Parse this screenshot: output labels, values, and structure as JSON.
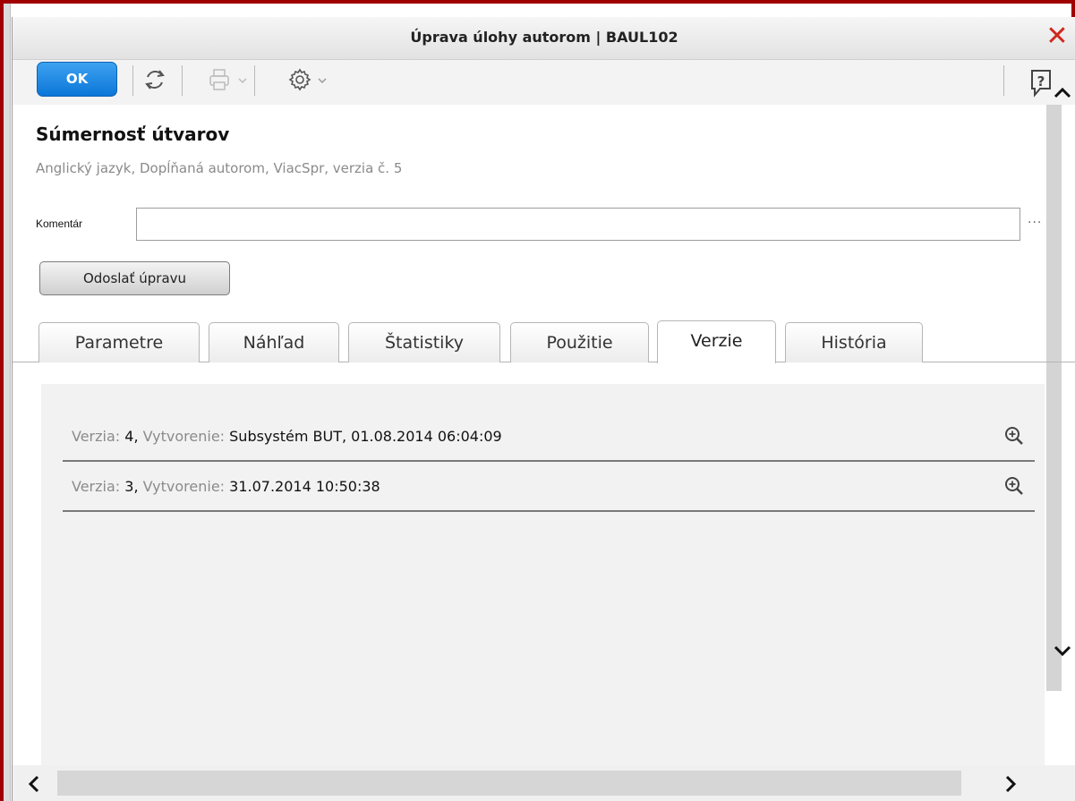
{
  "window": {
    "title": "Úprava úlohy autorom | BAUL102",
    "close_icon": "close-x-icon",
    "close_color": "#d0271d",
    "frame_color": "#a00000"
  },
  "toolbar": {
    "ok_label": "OK",
    "ok_color": "#1a85e2",
    "icons": [
      "refresh-icon",
      "print-icon",
      "settings-gear-icon",
      "help-icon"
    ]
  },
  "task": {
    "title": "Súmernosť útvarov",
    "subtitle": "Anglický jazyk, Dopĺňaná autorom, ViacSpr, verzia č. 5"
  },
  "comment": {
    "label": "Komentár",
    "value": "",
    "more": "···"
  },
  "send_button": "Odoslať úpravu",
  "tabs": [
    {
      "label": "Parametre",
      "active": false
    },
    {
      "label": "Náhľad",
      "active": false
    },
    {
      "label": "Štatistiky",
      "active": false
    },
    {
      "label": "Použitie",
      "active": false
    },
    {
      "label": "Verzie",
      "active": true
    },
    {
      "label": "História",
      "active": false
    }
  ],
  "versions": [
    {
      "version_label": "Verzia:",
      "version": "4",
      "sep": ",",
      "created_label": "Vytvorenie:",
      "created": "Subsystém BUT, 01.08.2014 06:04:09"
    },
    {
      "version_label": "Verzia:",
      "version": "3",
      "sep": ",",
      "created_label": "Vytvorenie:",
      "created": "31.07.2014 10:50:38"
    }
  ]
}
